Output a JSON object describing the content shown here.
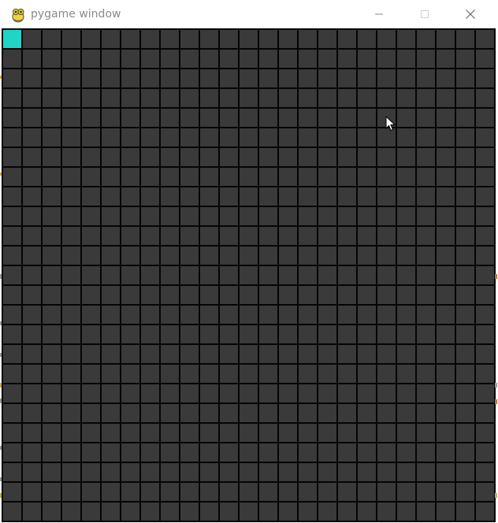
{
  "window": {
    "title": "pygame window",
    "controls": {
      "minimize_icon": "minimize-icon",
      "maximize_icon": "maximize-icon",
      "close_icon": "close-icon"
    }
  },
  "grid": {
    "rows": 25,
    "columns": 25,
    "active_cells": [
      [
        0,
        0
      ]
    ],
    "colors": {
      "background": "#050505",
      "cell": "#3a3a3a",
      "active": "#1fd6c6"
    }
  }
}
